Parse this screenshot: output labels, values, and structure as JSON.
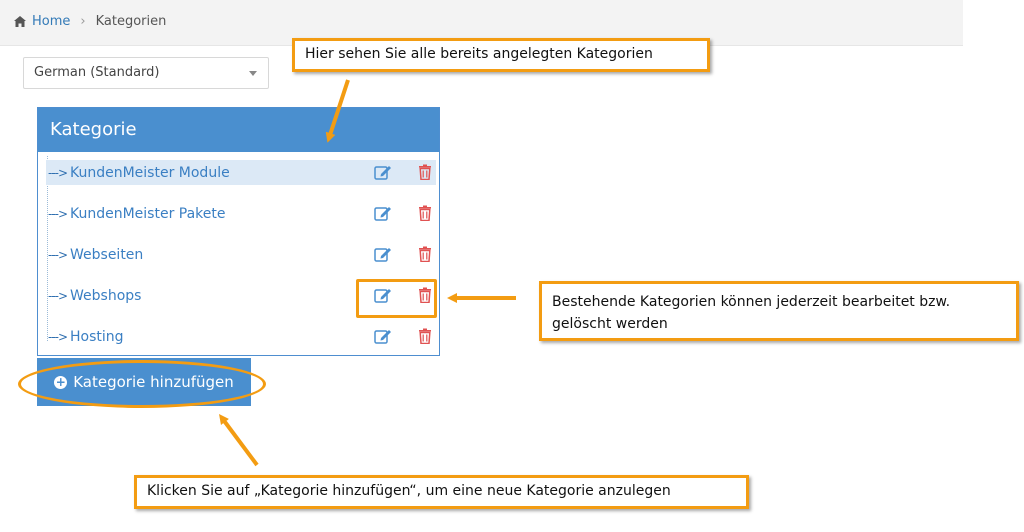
{
  "breadcrumb": {
    "home": "Home",
    "current": "Kategorien"
  },
  "language_select": {
    "value": "German (Standard)"
  },
  "panel": {
    "title": "Kategorie",
    "branch_glyph": "--->",
    "items": [
      {
        "label": "KundenMeister Module",
        "active": true
      },
      {
        "label": "KundenMeister Pakete",
        "active": false
      },
      {
        "label": "Webseiten",
        "active": false
      },
      {
        "label": "Webshops",
        "active": false
      },
      {
        "label": "Hosting",
        "active": false
      }
    ]
  },
  "add_button": {
    "label": "Kategorie hinzufügen"
  },
  "annotations": {
    "list_hint": "Hier sehen Sie alle bereits angelegten Kategorien",
    "actions_hint": "Bestehende Kategorien können jederzeit bearbeitet bzw. gelöscht werden",
    "add_hint": "Klicken Sie auf „Kategorie hinzufügen“, um eine neue Kategorie anzulegen"
  },
  "colors": {
    "accent": "#4a8fcf",
    "annotation": "#f39c12",
    "delete": "#e05252",
    "edit": "#4a8fcf"
  },
  "icons": {
    "home": "home-icon",
    "edit": "edit-icon",
    "delete": "trash-icon",
    "add": "plus-circle-icon",
    "dropdown": "caret-down-icon"
  }
}
